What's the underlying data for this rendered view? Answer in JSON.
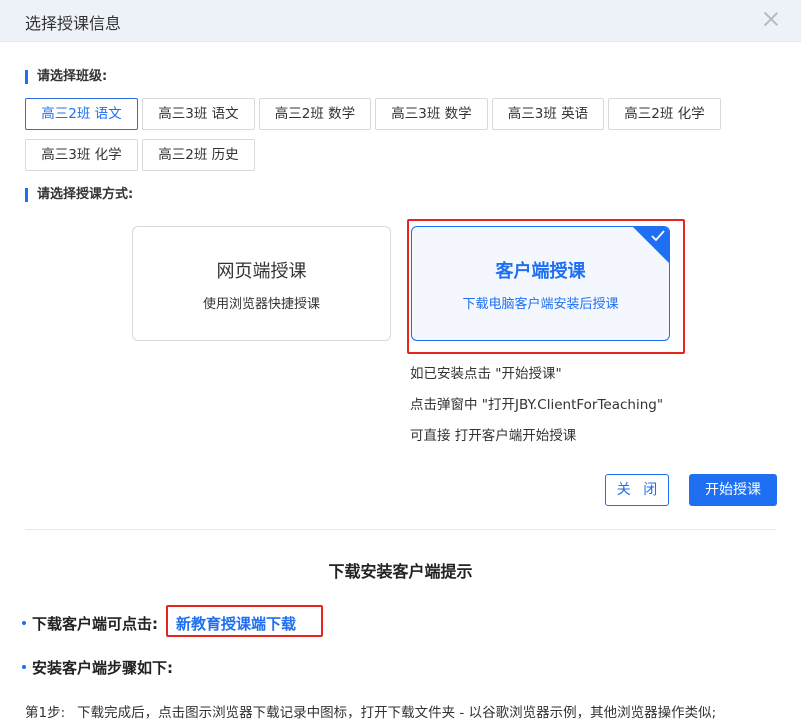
{
  "dialog": {
    "title": "选择授课信息"
  },
  "class_section": {
    "label": "请选择班级:",
    "classes": [
      {
        "label": "高三2班 语文",
        "selected": true
      },
      {
        "label": "高三3班 语文",
        "selected": false
      },
      {
        "label": "高三2班 数学",
        "selected": false
      },
      {
        "label": "高三3班 数学",
        "selected": false
      },
      {
        "label": "高三3班 英语",
        "selected": false
      },
      {
        "label": "高三2班 化学",
        "selected": false
      },
      {
        "label": "高三3班 化学",
        "selected": false
      },
      {
        "label": "高三2班 历史",
        "selected": false
      }
    ]
  },
  "mode_section": {
    "label": "请选择授课方式:",
    "web": {
      "title": "网页端授课",
      "subtitle": "使用浏览器快捷授课"
    },
    "client": {
      "title": "客户端授课",
      "subtitle": "下载电脑客户端安装后授课",
      "selected": true
    }
  },
  "hints": [
    "如已安装点击 \"开始授课\"",
    "点击弹窗中 \"打开JBY.ClientForTeaching\"",
    "可直接 打开客户端开始授课"
  ],
  "actions": {
    "close_label": "关 闭",
    "start_label": "开始授课"
  },
  "download_tip": {
    "title": "下载安装客户端提示",
    "download_prefix": "下载客户端可点击:",
    "download_link": "新教育授课端下载",
    "install_heading": "安装客户端步骤如下:",
    "step1_label": "第1步:",
    "step1_text": "下载完成后，点击图示浏览器下载记录中图标，打开下载文件夹 - 以谷歌浏览器示例，其他浏览器操作类似;"
  },
  "colors": {
    "accent": "#1e6ff1",
    "highlight_red": "#e5241e",
    "header_bg": "#edf2f9"
  }
}
